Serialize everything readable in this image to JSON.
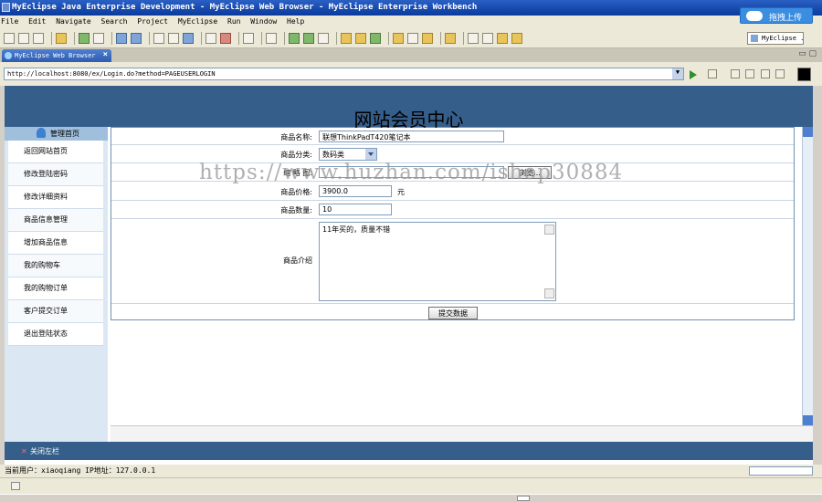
{
  "window": {
    "title": "MyEclipse Java Enterprise Development - MyEclipse Web Browser - MyEclipse Enterprise Workbench",
    "cloud_button": "拖拽上传"
  },
  "menu": [
    "File",
    "Edit",
    "Navigate",
    "Search",
    "Project",
    "MyEclipse",
    "Run",
    "Window",
    "Help"
  ],
  "perspective": "MyEclipse ...",
  "tab": {
    "label": "MyEclipse Web Browser"
  },
  "browser": {
    "url": "http://localhost:8080/ex/Login.do?method=PAGEUSERLOGIN"
  },
  "page": {
    "title": "网站会员中心",
    "sidebar": {
      "header": "管理首页",
      "items": [
        "返回网站首页",
        "修改登陆密码",
        "修改详细资料",
        "商品信息管理",
        "增加商品信息",
        "我的购物车",
        "我的购物订单",
        "客户提交订单",
        "退出登陆状态"
      ]
    },
    "form": {
      "name_label": "商品名称:",
      "name_value": "联想ThinkPadT420笔记本",
      "category_label": "商品分类:",
      "category_value": "数码类",
      "image_label": "缩 略 图:",
      "image_value": "",
      "browse_button": "浏览...",
      "price_label": "商品价格:",
      "price_value": "3900.0",
      "price_unit": "元",
      "qty_label": "商品数量:",
      "qty_value": "10",
      "intro_label": "商品介绍",
      "intro_value": "11年买的，质量不错",
      "submit_button": "提交数据"
    },
    "footer": {
      "close_sidebar": "关闭左栏"
    }
  },
  "watermark": "https://www.huzhan.com/ishop30884",
  "status": {
    "user_info": "当前用户：xiaoqiang  IP地址：127.0.0.1"
  }
}
